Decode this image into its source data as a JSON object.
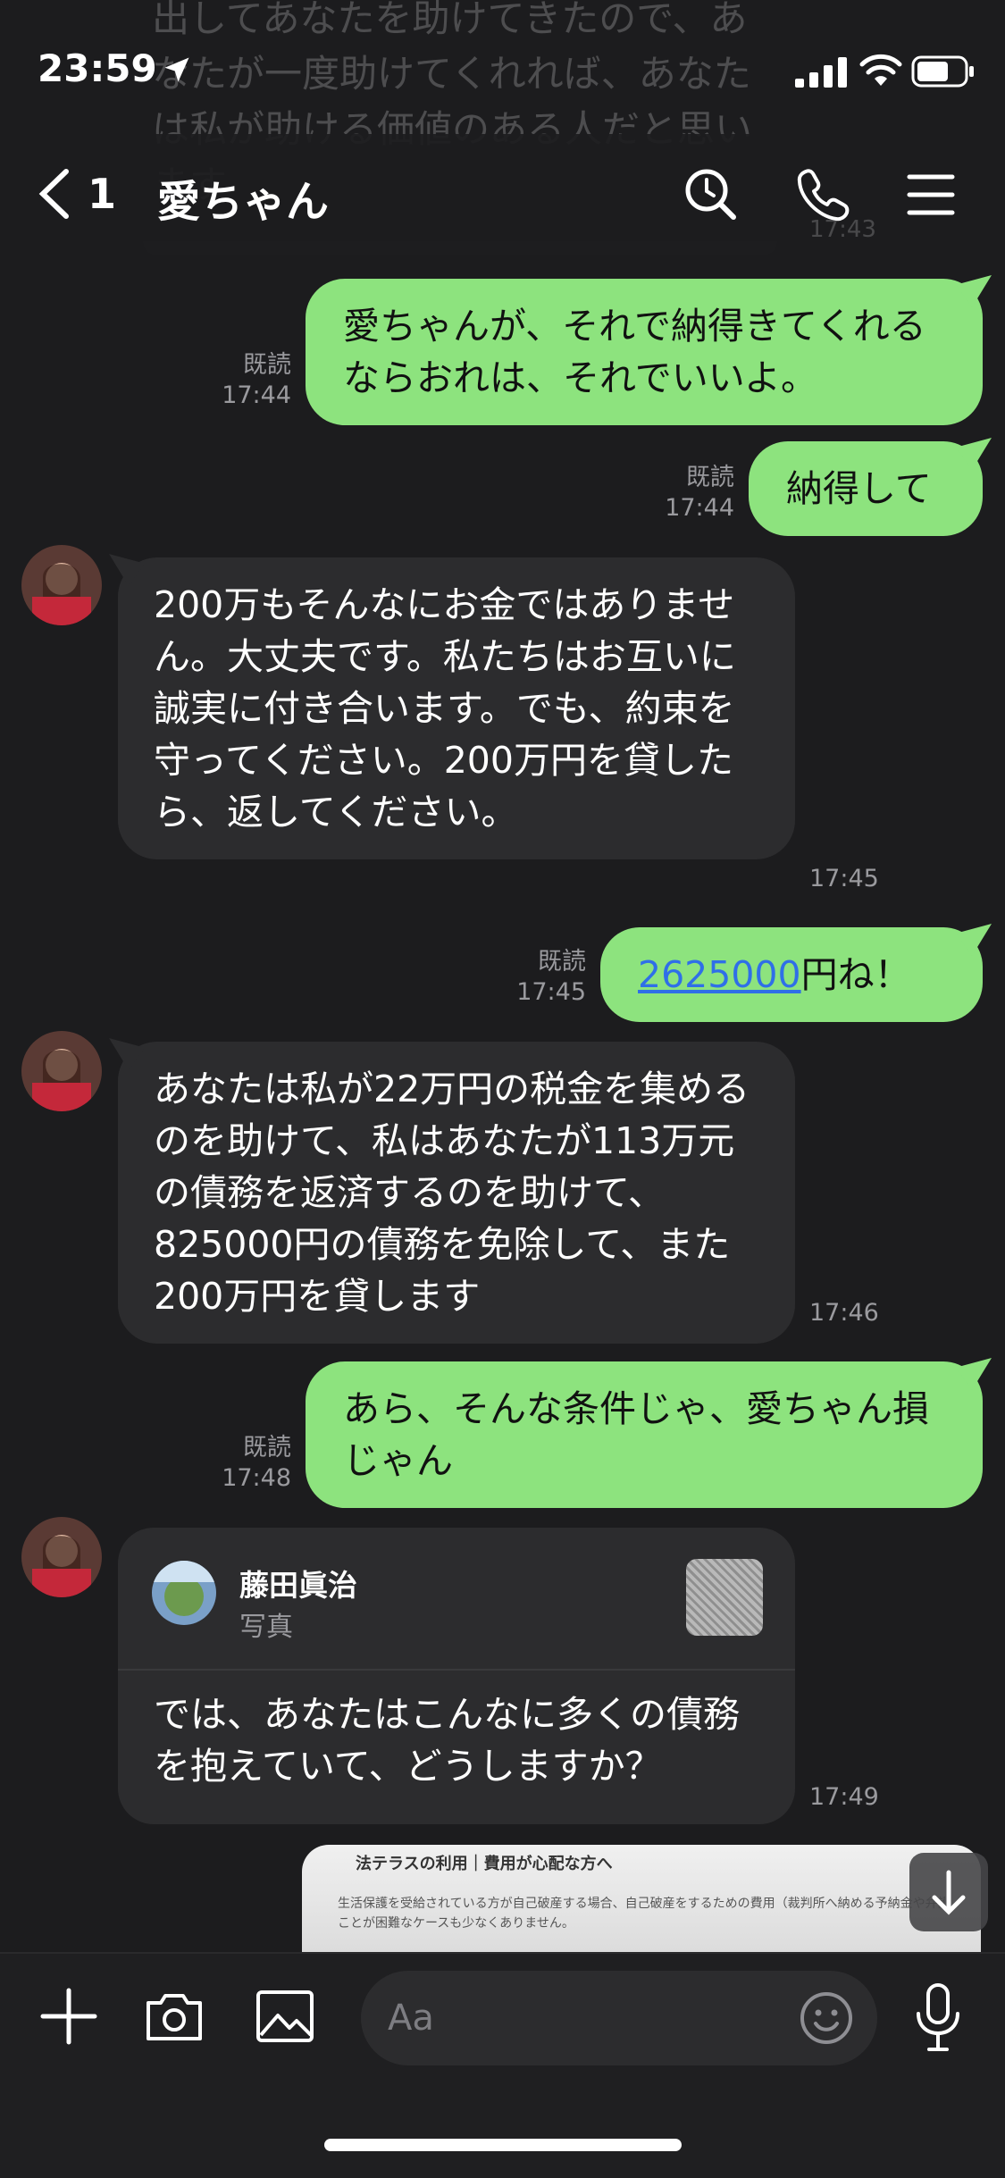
{
  "status_bar": {
    "time": "23:59"
  },
  "header": {
    "back_count": "1",
    "title": "愛ちゃん"
  },
  "remnant": {
    "text": "出してあなたを助けてきたので、あなたが一度助けてくれれば、あなたは私が助ける価値のある人だと思います",
    "time": "17:43"
  },
  "messages": [
    {
      "dir": "out",
      "text": "愛ちゃんが、それで納得きてくれるならおれは、それでいいよ。",
      "read": "既読",
      "time": "17:44"
    },
    {
      "dir": "out",
      "text": "納得して",
      "read": "既読",
      "time": "17:44"
    },
    {
      "dir": "in",
      "text": "200万もそんなにお金ではありません。大丈夫です。私たちはお互いに誠実に付き合います。でも、約束を守ってください。200万円を貸したら、返してください。",
      "time": "17:45"
    },
    {
      "dir": "out",
      "link": "2625000",
      "text": "円ね！",
      "read": "既読",
      "time": "17:45"
    },
    {
      "dir": "in",
      "text": "あなたは私が22万円の税金を集めるのを助けて、私はあなたが113万元の債務を返済するのを助けて、825000円の債務を免除して、また200万円を貸します",
      "time": "17:46"
    },
    {
      "dir": "out",
      "text": "あら、そんな条件じゃ、愛ちゃん損じゃん",
      "read": "既読",
      "time": "17:48"
    },
    {
      "dir": "in",
      "card_name": "藤田眞治",
      "card_type": "写真",
      "text": "では、あなたはこんなに多くの債務を抱えていて、どうしますか？",
      "time": "17:49"
    }
  ],
  "photo_preview": {
    "title": "法テラスの利用｜費用が心配な方へ",
    "line1": "生活保護を受給されている方が自己破産する場合、自己破産をするための費用（裁判所へ納める予納金や弁護士費用など）をお持ち",
    "line2": "ことが困難なケースも少なくありません。"
  },
  "input": {
    "placeholder": "Aa"
  },
  "icons": {
    "location": "location-arrow-icon",
    "back": "chevron-left-icon",
    "search": "search-clock-icon",
    "call": "phone-icon",
    "menu": "hamburger-menu-icon",
    "plus": "plus-icon",
    "camera": "camera-icon",
    "image": "image-icon",
    "emoji": "emoji-icon",
    "mic": "microphone-icon",
    "scroll": "arrow-down-icon"
  },
  "colors": {
    "outgoing_bubble": "#8de37e",
    "incoming_bubble": "#2c2c2e",
    "background": "#1c1c1e",
    "link": "#2f6fe8"
  }
}
